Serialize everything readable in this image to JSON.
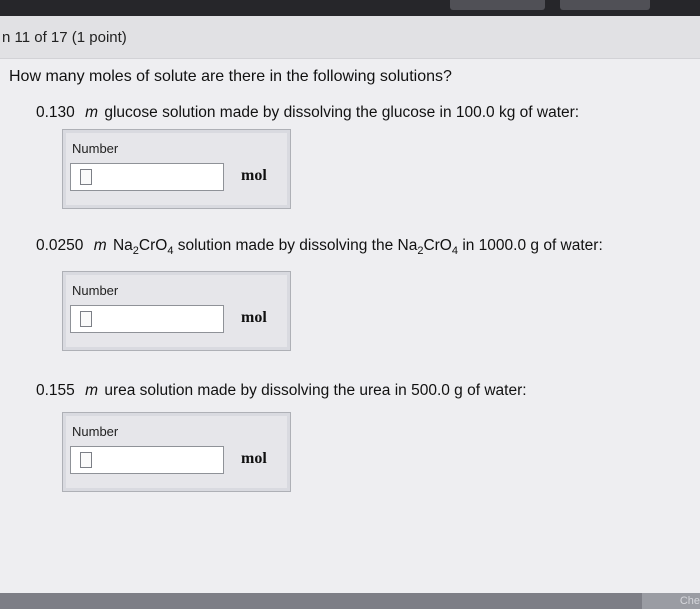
{
  "header": {
    "title": "n 11 of 17 (1 point)"
  },
  "question": {
    "prompt": "How many moles of solute are there in the following solutions?"
  },
  "problems": [
    {
      "concentration": "0.130",
      "unit_symbol": "m",
      "text": "glucose solution made by dissolving the glucose in 100.0 kg of water:",
      "field_label": "Number",
      "value": "",
      "answer_unit": "mol"
    },
    {
      "concentration": "0.0250",
      "unit_symbol": "m",
      "formula_parts": [
        "Na",
        "2",
        "CrO",
        "4"
      ],
      "text_mid": "solution made by dissolving the",
      "text_end": "in 1000.0 g of water:",
      "field_label": "Number",
      "value": "",
      "answer_unit": "mol"
    },
    {
      "concentration": "0.155",
      "unit_symbol": "m",
      "text": "urea solution made by dissolving the urea in 500.0 g of water:",
      "field_label": "Number",
      "value": "",
      "answer_unit": "mol"
    }
  ],
  "footer": {
    "corner_text": "Che"
  }
}
